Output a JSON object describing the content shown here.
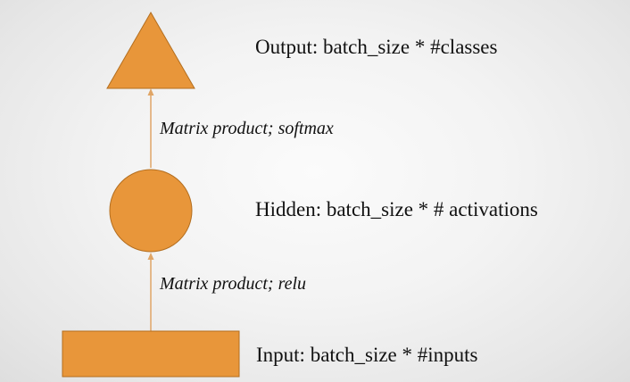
{
  "colors": {
    "node_fill": "#e8963a",
    "node_stroke": "#b36e1f",
    "edge": "#e0a566",
    "text": "#111111",
    "background": "#f3f3f3"
  },
  "nodes": {
    "output": {
      "shape": "triangle",
      "label": "Output: batch_size * #classes"
    },
    "hidden": {
      "shape": "circle",
      "label": "Hidden: batch_size * # activations"
    },
    "input": {
      "shape": "rectangle",
      "label": "Input: batch_size * #inputs"
    }
  },
  "edges": {
    "input_to_hidden": {
      "label": "Matrix product; relu"
    },
    "hidden_to_output": {
      "label": "Matrix product; softmax"
    }
  }
}
